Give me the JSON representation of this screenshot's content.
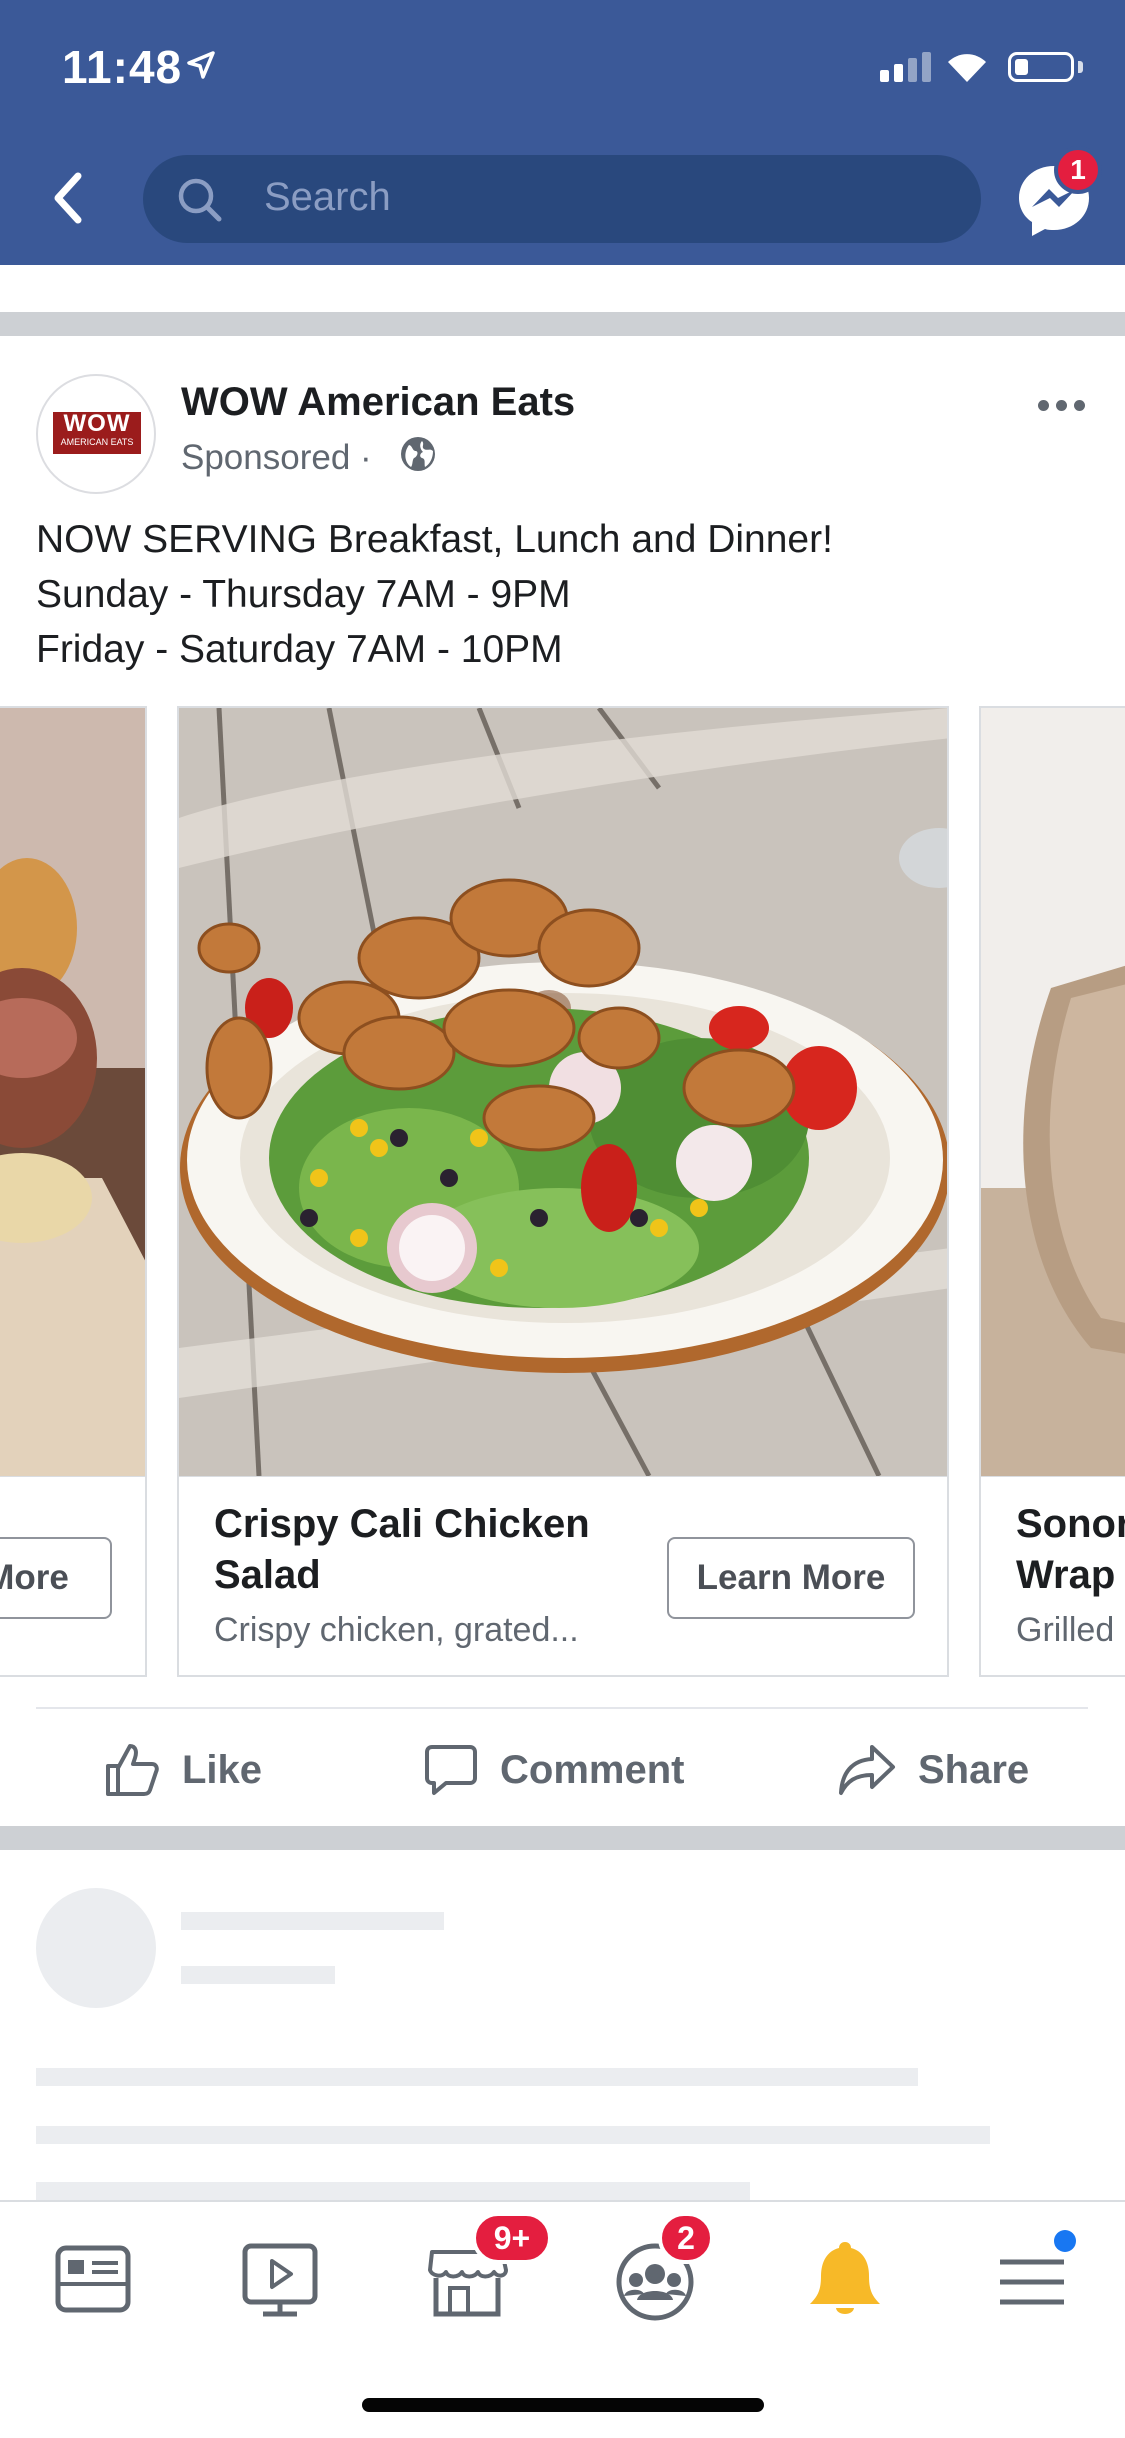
{
  "status_bar": {
    "time": "11:48",
    "signal_bars": 2,
    "battery_level": 0.2
  },
  "header": {
    "search_placeholder": "Search",
    "messenger_badge": "1",
    "colors": {
      "bar": "#3b5998",
      "search_field": "#29487d",
      "badge": "#e41e3f"
    }
  },
  "post": {
    "page_name": "WOW American Eats",
    "logo_text": "WOW",
    "logo_subtext": "AMERICAN EATS",
    "sponsored_label": "Sponsored",
    "separator": "·",
    "text_lines": [
      "NOW SERVING Breakfast, Lunch and Dinner!",
      "Sunday - Thursday 7AM - 9PM",
      "Friday - Saturday 7AM - 10PM"
    ],
    "carousel": [
      {
        "title": "",
        "description": "",
        "button": "More"
      },
      {
        "title_line1": "Crispy Cali Chicken",
        "title_line2": "Salad",
        "description": "Crispy chicken, grated...",
        "button": "Learn More"
      },
      {
        "title_line1": "Sonor",
        "title_line2": "Wrap",
        "description": "Grilled"
      }
    ],
    "actions": {
      "like": "Like",
      "comment": "Comment",
      "share": "Share"
    }
  },
  "tabbar": {
    "items": [
      {
        "name": "news-feed"
      },
      {
        "name": "watch"
      },
      {
        "name": "marketplace",
        "badge": "9+"
      },
      {
        "name": "groups",
        "badge": "2"
      },
      {
        "name": "notifications"
      },
      {
        "name": "menu",
        "dot": true
      }
    ],
    "colors": {
      "bell": "#f7b928",
      "menu_dot": "#1877f2"
    }
  }
}
